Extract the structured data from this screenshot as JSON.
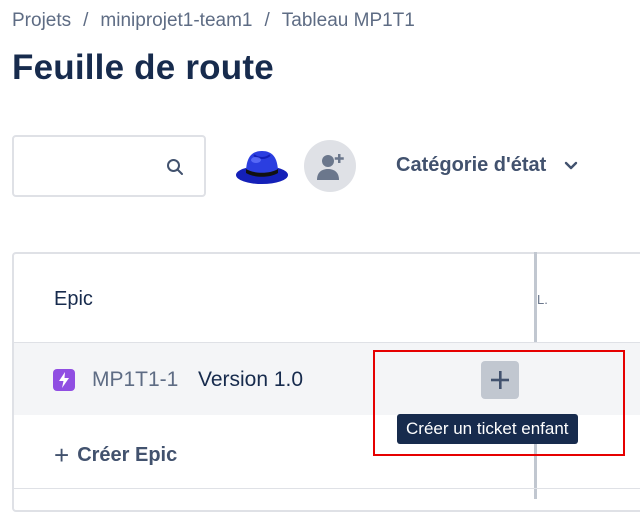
{
  "breadcrumb": {
    "items": [
      "Projets",
      "miniprojet1-team1",
      "Tableau MP1T1"
    ],
    "separator": "/"
  },
  "page_title": "Feuille de route",
  "toolbar": {
    "search": {
      "value": "",
      "placeholder": "",
      "icon": "search-icon"
    },
    "avatar_icon": "red-hat-avatar-icon",
    "add_people_icon": "add-user-icon",
    "status_filter_label": "Catégorie d'état",
    "status_filter_icon": "chevron-down-icon"
  },
  "roadmap": {
    "column_header": "Epic",
    "timeline_header_clip": "L.",
    "epics": [
      {
        "key": "MP1T1-1",
        "name": "Version 1.0",
        "icon": "epic-lightning-icon",
        "icon_color": "#904ee2"
      }
    ],
    "create_epic_label": "Créer Epic",
    "add_child_icon": "plus-icon"
  },
  "tooltip": "Créer un ticket enfant",
  "colors": {
    "text_primary": "#172b4d",
    "text_secondary": "#5e6c84",
    "epic_purple": "#904ee2",
    "tooltip_bg": "#172b4d",
    "highlight_red": "#e60000",
    "row_hover": "#f4f5f7"
  }
}
